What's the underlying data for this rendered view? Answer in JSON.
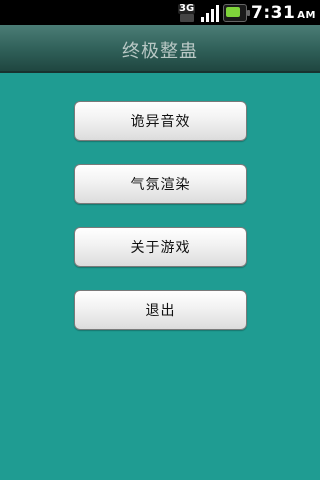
{
  "status_bar": {
    "network_type": "3G",
    "time": "7:31",
    "ampm": "AM",
    "icons": [
      "3g-icon",
      "signal-icon",
      "battery-charging-icon"
    ]
  },
  "title_bar": {
    "title": "终极整蛊"
  },
  "menu": {
    "buttons": [
      {
        "label": "诡异音效"
      },
      {
        "label": "气氛渲染"
      },
      {
        "label": "关于游戏"
      },
      {
        "label": "退出"
      }
    ]
  },
  "colors": {
    "background": "#1f9c92",
    "title_bar": "#2f5f58",
    "button_bg": "#eeeeee",
    "status_bar": "#000000"
  }
}
